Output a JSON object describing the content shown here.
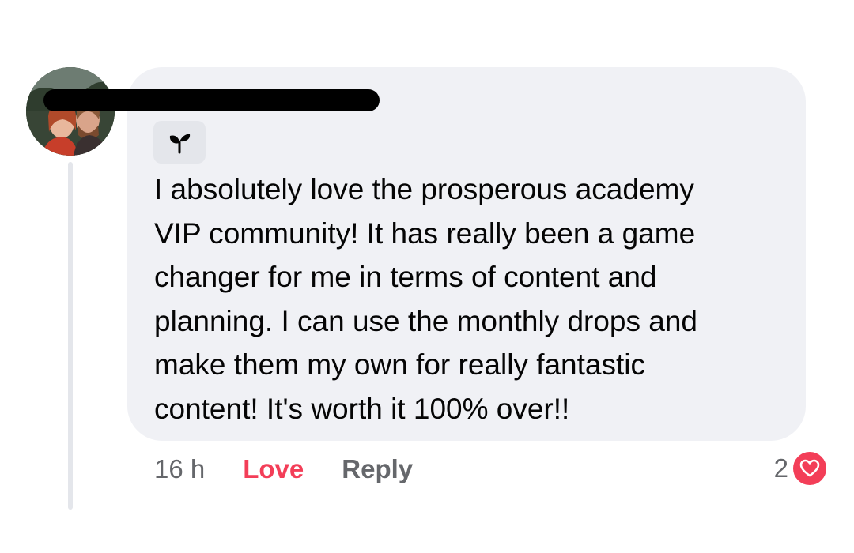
{
  "comment": {
    "badge_icon": "sprout-icon",
    "text": "I absolutely love the prosperous academy\nVIP community! It has really been a game\nchanger for me in terms of content and\nplanning. I can use the monthly drops and\nmake them my own for really fantastic\ncontent! It's worth it 100% over!!"
  },
  "actions": {
    "timestamp": "16 h",
    "love_label": "Love",
    "reply_label": "Reply"
  },
  "reactions": {
    "count": "2",
    "icon": "heart-icon",
    "color": "#f33e58"
  },
  "colors": {
    "bubble": "#f0f1f5",
    "love": "#f33e58",
    "muted": "#65676b",
    "text": "#050505"
  }
}
